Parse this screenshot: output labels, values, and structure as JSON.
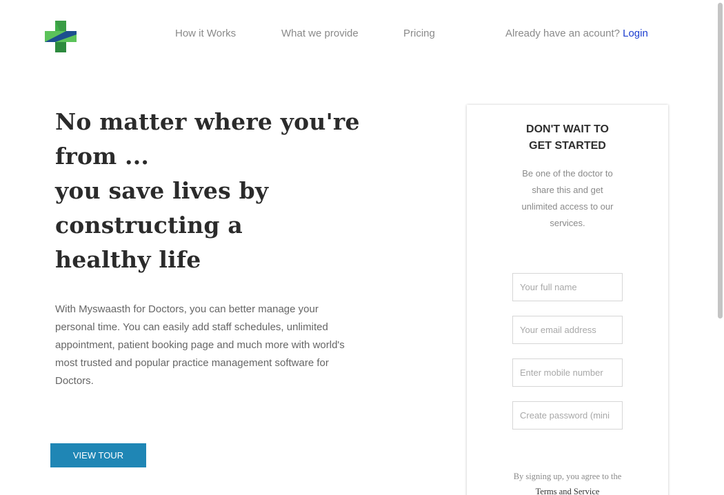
{
  "header": {
    "logo_icon": "medical-cross-logo",
    "nav": [
      {
        "label": "How it Works"
      },
      {
        "label": "What we provide"
      },
      {
        "label": "Pricing"
      }
    ],
    "account_prompt": "Already have an acount?",
    "login_label": "Login"
  },
  "hero": {
    "lines": [
      "No matter where you're",
      "from ...",
      "you save lives by",
      "constructing a",
      "healthy life"
    ],
    "description": "With Myswaasth for Doctors, you can better manage your personal time. You can easily add staff schedules, unlimited appointment, patient booking page and much more with world's most trusted and popular practice management software for Doctors.",
    "tour_button": "VIEW TOUR"
  },
  "signup": {
    "title_line1": "DON'T WAIT TO",
    "title_line2": "GET STARTED",
    "subtitle": "Be one of the doctor to share this and get unlimited access to our services.",
    "fields": {
      "full_name_placeholder": "Your full name",
      "email_placeholder": "Your email address",
      "mobile_placeholder": "Enter mobile number",
      "password_placeholder": "Create password (mini"
    },
    "terms_prefix": "By signing up, you agree to the",
    "terms_link": "Terms and Service"
  },
  "colors": {
    "accent_button": "#1f86b5",
    "login_link": "#1a3ccf",
    "logo_green": "#3fae49",
    "logo_dark": "#2d6b3a",
    "logo_blue": "#1d4f8f"
  }
}
